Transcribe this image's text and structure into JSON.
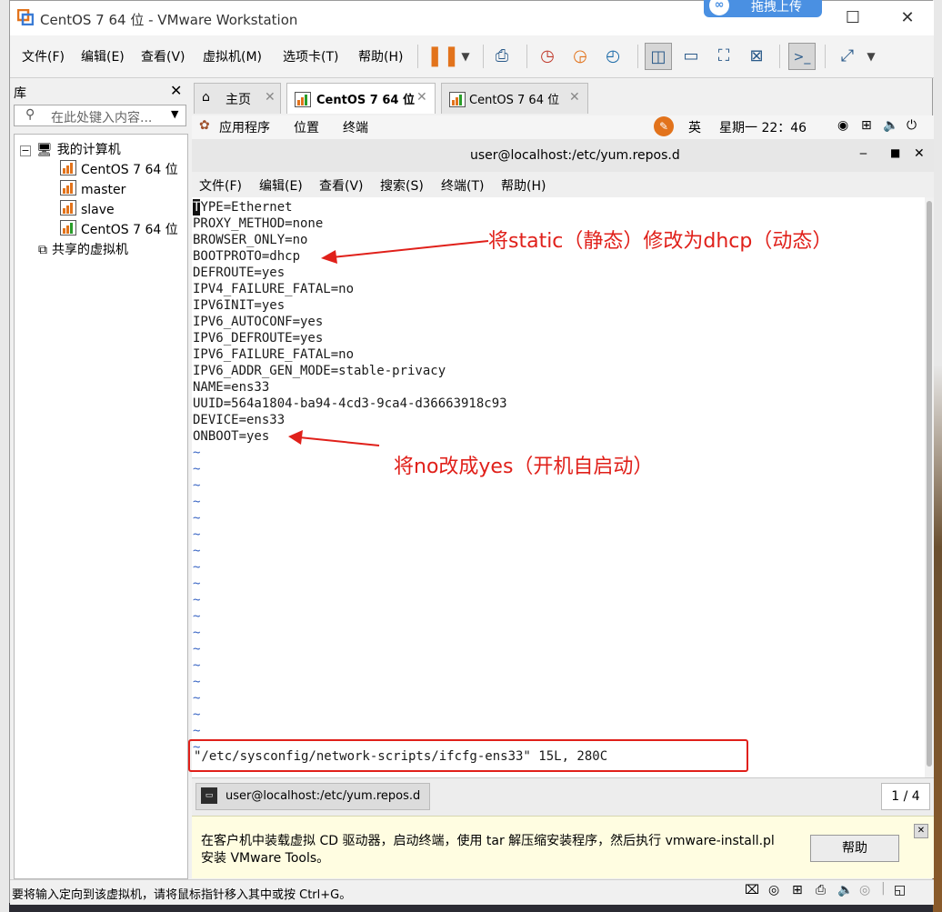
{
  "window": {
    "title": "CentOS 7 64 位 - VMware Workstation",
    "upload_label": "拖拽上传"
  },
  "menubar": {
    "items": [
      "文件(F)",
      "编辑(E)",
      "查看(V)",
      "虚拟机(M)",
      "选项卡(T)",
      "帮助(H)"
    ]
  },
  "library": {
    "header": "库",
    "search_placeholder": "在此处键入内容...",
    "root": "我的计算机",
    "vms": [
      "CentOS 7 64 位",
      "master",
      "slave",
      "CentOS 7 64 位"
    ],
    "shared": "共享的虚拟机"
  },
  "tabs": [
    {
      "label": "主页",
      "icon": "home-icon"
    },
    {
      "label": "CentOS 7 64 位",
      "icon": "vm-running-icon",
      "active": true
    },
    {
      "label": "CentOS 7 64 位",
      "icon": "vm-running-icon"
    }
  ],
  "guest": {
    "topbar": {
      "apps": "应用程序",
      "places": "位置",
      "terminal": "终端",
      "lang": "英",
      "clock": "星期一 22：46"
    },
    "terminal_title": "user@localhost:/etc/yum.repos.d",
    "terminal_menu": [
      "文件(F)",
      "编辑(E)",
      "查看(V)",
      "搜索(S)",
      "终端(T)",
      "帮助(H)"
    ],
    "lines": [
      "TYPE=Ethernet",
      "PROXY_METHOD=none",
      "BROWSER_ONLY=no",
      "BOOTPROTO=dhcp",
      "DEFROUTE=yes",
      "IPV4_FAILURE_FATAL=no",
      "IPV6INIT=yes",
      "IPV6_AUTOCONF=yes",
      "IPV6_DEFROUTE=yes",
      "IPV6_FAILURE_FATAL=no",
      "IPV6_ADDR_GEN_MODE=stable-privacy",
      "NAME=ens33",
      "UUID=564a1804-ba94-4cd3-9ca4-d36663918c93",
      "DEVICE=ens33",
      "ONBOOT=yes"
    ],
    "tilde": "~",
    "status_line": "\"/etc/sysconfig/network-scripts/ifcfg-ens33\" 15L, 280C",
    "annotation_1": "将static（静态）修改为dhcp（动态）",
    "annotation_2": "将no改成yes（开机自启动）",
    "taskbar_item": "user@localhost:/etc/yum.repos.d",
    "taskbar_pager": "1 / 4"
  },
  "notice": {
    "line1": "在客户机中装载虚拟 CD 驱动器，启动终端，使用 tar 解压缩安装程序，然后执行 vmware-install.pl",
    "line2": "安装 VMware Tools。",
    "help_button": "帮助"
  },
  "statusbar": {
    "text": "要将输入定向到该虚拟机，请将鼠标指针移入其中或按 Ctrl+G。"
  },
  "colors": {
    "annotation": "#e0201a",
    "tilde": "#3a66c4",
    "accent": "#e2731c"
  }
}
